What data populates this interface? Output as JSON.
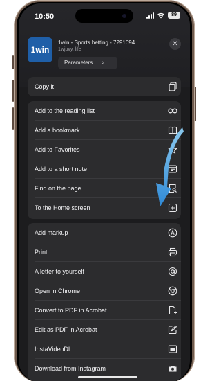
{
  "status_bar": {
    "time": "10:50",
    "battery": "89"
  },
  "app_header": {
    "logo_text": "1win",
    "title": "1win - Sports betting - 7291094...",
    "url": "1wjpvy. life",
    "parameters_label": "Parameters",
    "parameters_chevron": ">",
    "close_icon": "close-icon"
  },
  "menu": {
    "copy": {
      "label": "Copy it",
      "icon": "copy-icon"
    },
    "group1": [
      {
        "label": "Add to the reading list",
        "icon": "glasses-icon"
      },
      {
        "label": "Add a bookmark",
        "icon": "book-icon"
      },
      {
        "label": "Add to Favorites",
        "icon": "star-icon"
      },
      {
        "label": "Add to a short note",
        "icon": "note-icon"
      },
      {
        "label": "Find on the page",
        "icon": "find-in-page-icon"
      },
      {
        "label": "To the Home screen",
        "icon": "plus-square-icon"
      }
    ],
    "group2": [
      {
        "label": "Add  markup",
        "icon": "markup-icon"
      },
      {
        "label": "Print",
        "icon": "printer-icon"
      },
      {
        "label": "A letter to yourself",
        "icon": "at-icon"
      },
      {
        "label": "Open in Chrome",
        "icon": "chrome-icon"
      },
      {
        "label": "Convert to PDF in Acrobat",
        "icon": "pdf-convert-icon"
      },
      {
        "label": "Edit as PDF in Acrobat",
        "icon": "edit-icon"
      },
      {
        "label": "InstaVideoDL",
        "icon": "video-icon"
      },
      {
        "label": "Download from Instagram",
        "icon": "camera-icon"
      }
    ]
  },
  "colors": {
    "menu_background": "#2c2c2e",
    "screen_background": "#1c1c1e",
    "arrow_color": "#3d9fe6",
    "logo_background": "#1f5fa8",
    "frame_color": "#6e5a4d"
  }
}
